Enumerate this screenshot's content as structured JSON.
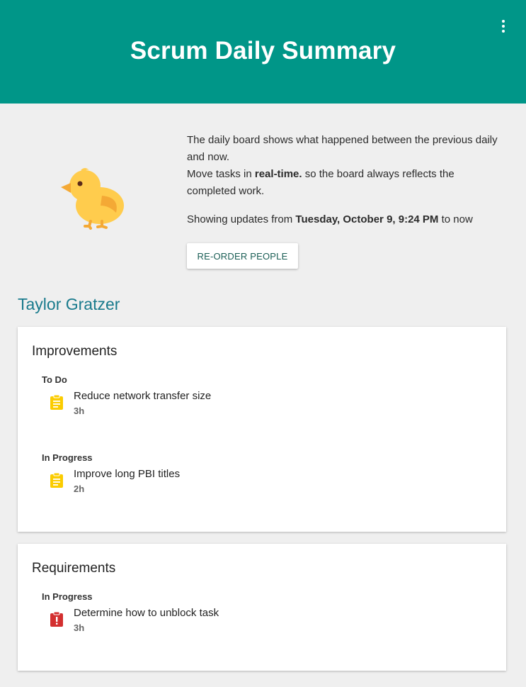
{
  "header": {
    "title": "Scrum Daily Summary"
  },
  "intro": {
    "line1": "The daily board shows what happened between the previous daily and now.",
    "line2_prefix": "Move tasks in ",
    "line2_bold": "real-time.",
    "line2_suffix": " so the board always reflects the completed work.",
    "since_prefix": "Showing updates from ",
    "since_date": "Tuesday, October 9, 9:24 PM",
    "since_suffix": " to now",
    "reorder_label": "RE-ORDER PEOPLE"
  },
  "person": {
    "name": "Taylor Gratzer"
  },
  "groups": [
    {
      "title": "Improvements",
      "sections": [
        {
          "state": "To Do",
          "tasks": [
            {
              "name": "Reduce network transfer size",
              "hours": "3h",
              "icon": "task-clipboard-icon",
              "color": "#fbcc00"
            }
          ]
        },
        {
          "state": "In Progress",
          "tasks": [
            {
              "name": "Improve long PBI titles",
              "hours": "2h",
              "icon": "task-clipboard-icon",
              "color": "#fbcc00"
            }
          ]
        }
      ]
    },
    {
      "title": "Requirements",
      "sections": [
        {
          "state": "In Progress",
          "tasks": [
            {
              "name": "Determine how to unblock task",
              "hours": "3h",
              "icon": "impediment-clipboard-icon",
              "color": "#d32f2f"
            }
          ]
        }
      ]
    }
  ],
  "colors": {
    "header": "#009688",
    "person": "#187a8c",
    "task_yellow": "#fbcc00",
    "task_red": "#d32f2f"
  }
}
